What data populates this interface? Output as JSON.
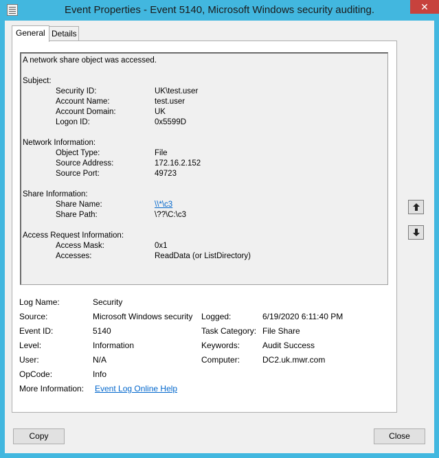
{
  "window": {
    "title": "Event Properties - Event 5140, Microsoft Windows security auditing.",
    "close_glyph": "✕"
  },
  "tabs": [
    {
      "label": "General",
      "active": true
    },
    {
      "label": "Details",
      "active": false
    }
  ],
  "description": {
    "summary": "A network share object was accessed.",
    "sections": [
      {
        "heading": "Subject:",
        "fields": [
          {
            "label": "Security ID:",
            "value": "UK\\test.user"
          },
          {
            "label": "Account Name:",
            "value": "test.user"
          },
          {
            "label": "Account Domain:",
            "value": "UK"
          },
          {
            "label": "Logon ID:",
            "value": "0x5599D"
          }
        ]
      },
      {
        "heading": "Network Information:",
        "fields": [
          {
            "label": "Object Type:",
            "value": "File"
          },
          {
            "label": "Source Address:",
            "value": "172.16.2.152"
          },
          {
            "label": "Source Port:",
            "value": "49723"
          }
        ]
      },
      {
        "heading": "Share Information:",
        "fields": [
          {
            "label": "Share Name:",
            "value": "\\\\*\\c3"
          },
          {
            "label": "Share Path:",
            "value": "\\??\\C:\\c3"
          }
        ]
      },
      {
        "heading": "Access Request Information:",
        "fields": [
          {
            "label": "Access Mask:",
            "value": "0x1"
          },
          {
            "label": "Accesses:",
            "value": "ReadData (or ListDirectory)"
          }
        ]
      }
    ]
  },
  "details": {
    "log_name_label": "Log Name:",
    "log_name": "Security",
    "source_label": "Source:",
    "source": "Microsoft Windows security",
    "logged_label": "Logged:",
    "logged": "6/19/2020 6:11:40 PM",
    "event_id_label": "Event ID:",
    "event_id": "5140",
    "task_category_label": "Task Category:",
    "task_category": "File Share",
    "level_label": "Level:",
    "level": "Information",
    "keywords_label": "Keywords:",
    "keywords": "Audit Success",
    "user_label": "User:",
    "user": "N/A",
    "computer_label": "Computer:",
    "computer": "DC2.uk.mwr.com",
    "opcode_label": "OpCode:",
    "opcode": "Info",
    "more_info_label": "More Information:",
    "more_info_link": "Event Log Online Help"
  },
  "buttons": {
    "copy": "Copy",
    "close": "Close",
    "prev_icon": "arrow-up-icon",
    "next_icon": "arrow-down-icon"
  }
}
